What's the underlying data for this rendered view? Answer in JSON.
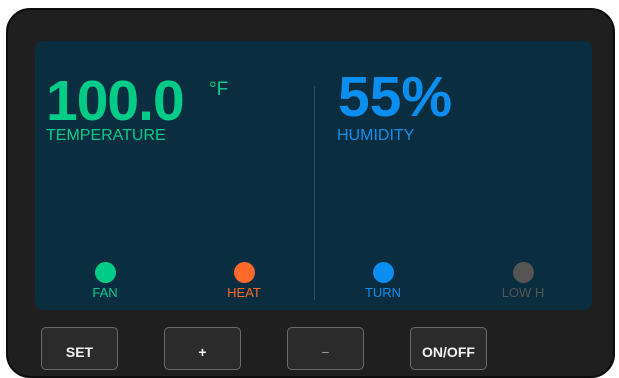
{
  "display": {
    "temperature": {
      "value": "100.0",
      "unit": "°F",
      "label": "TEMPERATURE"
    },
    "humidity": {
      "value": "55%",
      "label": "HUMIDITY"
    },
    "indicators": [
      {
        "label": "FAN",
        "color": "#00cc88",
        "active": true
      },
      {
        "label": "HEAT",
        "color": "#ff6a2a",
        "active": true
      },
      {
        "label": "TURN",
        "color": "#0a8ff0",
        "active": true
      },
      {
        "label": "LOW H",
        "color": "#555555",
        "active": false
      }
    ]
  },
  "buttons": {
    "set": "SET",
    "plus": "+",
    "minus": "−",
    "onoff": "ON/OFF"
  },
  "colors": {
    "temperature": "#00cc88",
    "humidity": "#0a8ff0",
    "heat": "#ff6a2a",
    "inactive": "#555555",
    "screen": "#0a2e3f",
    "bezel": "#1f1f1f"
  }
}
